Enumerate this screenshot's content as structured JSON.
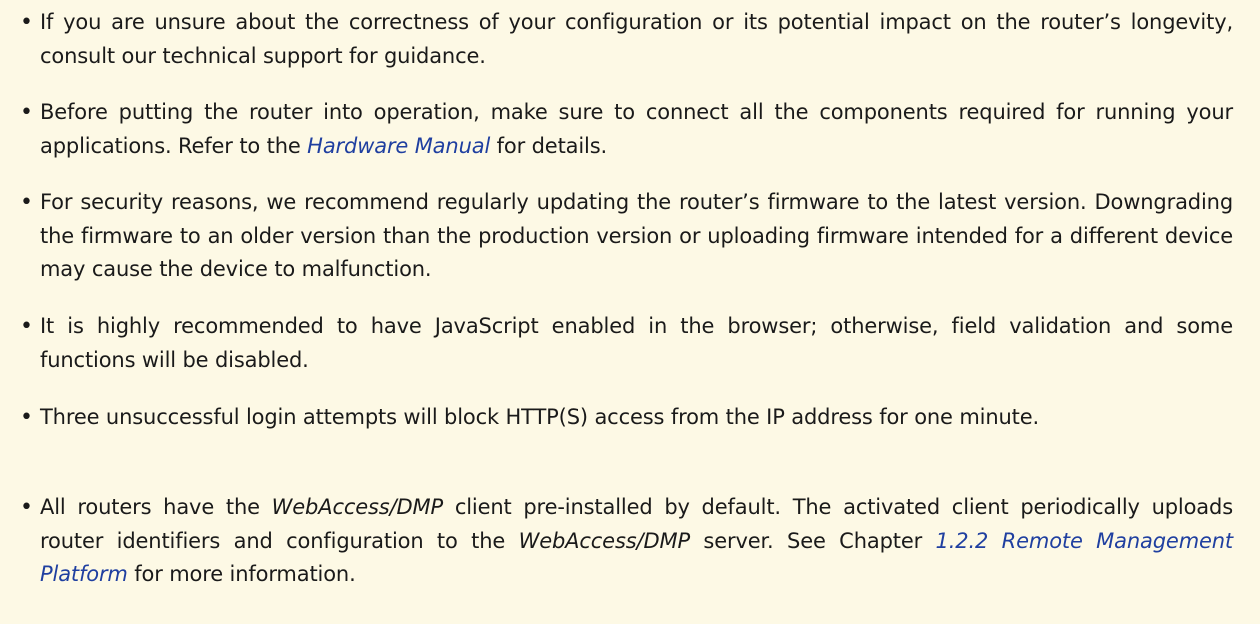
{
  "notes": [
    {
      "text": "If you are unsure about the correctness of your configuration or its potential impact on the router’s longevity, consult our technical support for guidance."
    },
    {
      "before": "Before putting the router into operation, make sure to connect all the components required for running your applications. Refer to the ",
      "link": "Hardware Manual",
      "after": " for details."
    },
    {
      "text": "For security reasons, we recommend regularly updating the router’s firmware to the latest version. Downgrading the firmware to an older version than the production version or uploading firmware intended for a different device may cause the device to malfunction."
    },
    {
      "text": "It is highly recommended to have JavaScript enabled in the browser; otherwise, field validation and some functions will be disabled."
    },
    {
      "text": "Three unsuccessful login attempts will block HTTP(S) access from the IP address for one minute."
    },
    {
      "part1": "All routers have the ",
      "emph1": "WebAccess/DMP",
      "part2": " client pre-installed by default. The activated client periodically uploads router identifiers and configuration to the ",
      "emph2": "WebAccess/DMP",
      "part3": " server. See Chapter ",
      "link": "1.2.2 Remote Management Platform",
      "part4": " for more information."
    }
  ],
  "bullet_char": "•",
  "colors": {
    "background": "#fdf9e5",
    "text": "#1a1a1a",
    "link": "#1f3fa0"
  }
}
